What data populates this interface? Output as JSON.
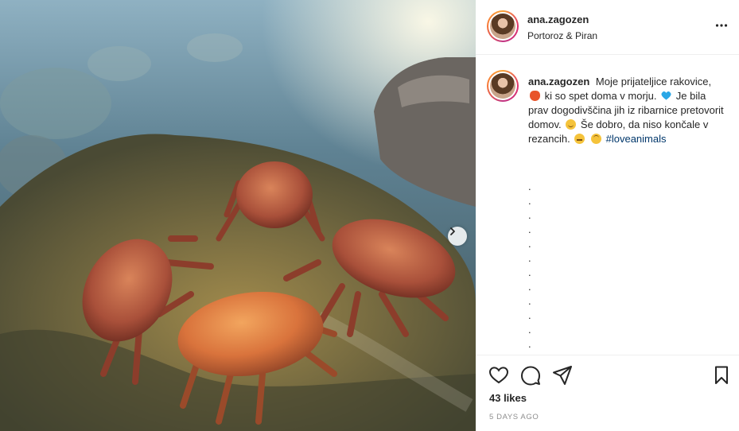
{
  "post": {
    "username": "ana.zagozen",
    "location": "Portoroz & Piran",
    "caption": {
      "part1": "Moje prijateljice rakovice,",
      "part2": "ki so spet doma v morju.",
      "part3": "Je bila prav dogodivščina jih iz ribarnice pretovorit domov.",
      "part4": "Še dobro, da niso končale v rezancih.",
      "hashtag": "#loveanimals"
    },
    "dot_char": ".",
    "likes": "43 likes",
    "timestamp": "5 days ago"
  },
  "icons": {
    "more": "more-options-icon",
    "next": "chevron-right-icon",
    "like": "heart-outline-icon",
    "comment": "comment-bubble-icon",
    "share": "paper-plane-icon",
    "save": "bookmark-icon"
  },
  "colors": {
    "text": "#262626",
    "link": "#00376b",
    "muted": "#8e8e8e",
    "divider": "#efefef"
  }
}
